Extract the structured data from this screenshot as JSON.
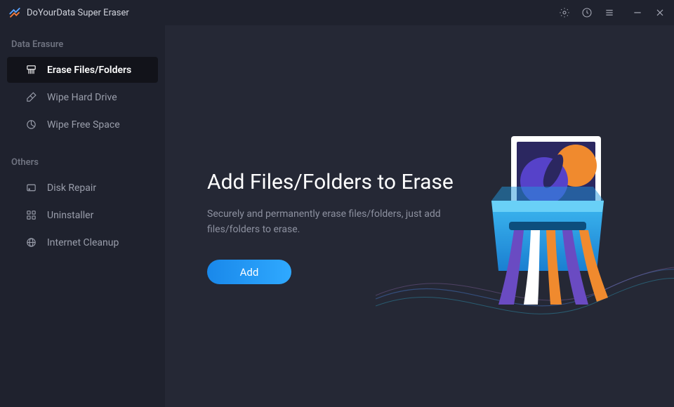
{
  "app": {
    "title": "DoYourData Super Eraser"
  },
  "sidebar": {
    "sections": [
      {
        "heading": "Data Erasure",
        "items": [
          {
            "label": "Erase Files/Folders",
            "icon": "shredder-icon",
            "active": true
          },
          {
            "label": "Wipe Hard Drive",
            "icon": "eraser-icon",
            "active": false
          },
          {
            "label": "Wipe Free Space",
            "icon": "pie-icon",
            "active": false
          }
        ]
      },
      {
        "heading": "Others",
        "items": [
          {
            "label": "Disk Repair",
            "icon": "drive-icon",
            "active": false
          },
          {
            "label": "Uninstaller",
            "icon": "grid-icon",
            "active": false
          },
          {
            "label": "Internet Cleanup",
            "icon": "globe-icon",
            "active": false
          }
        ]
      }
    ]
  },
  "main": {
    "heading": "Add Files/Folders to Erase",
    "subtext": "Securely and permanently erase files/folders, just add files/folders to erase.",
    "add_button_label": "Add"
  }
}
